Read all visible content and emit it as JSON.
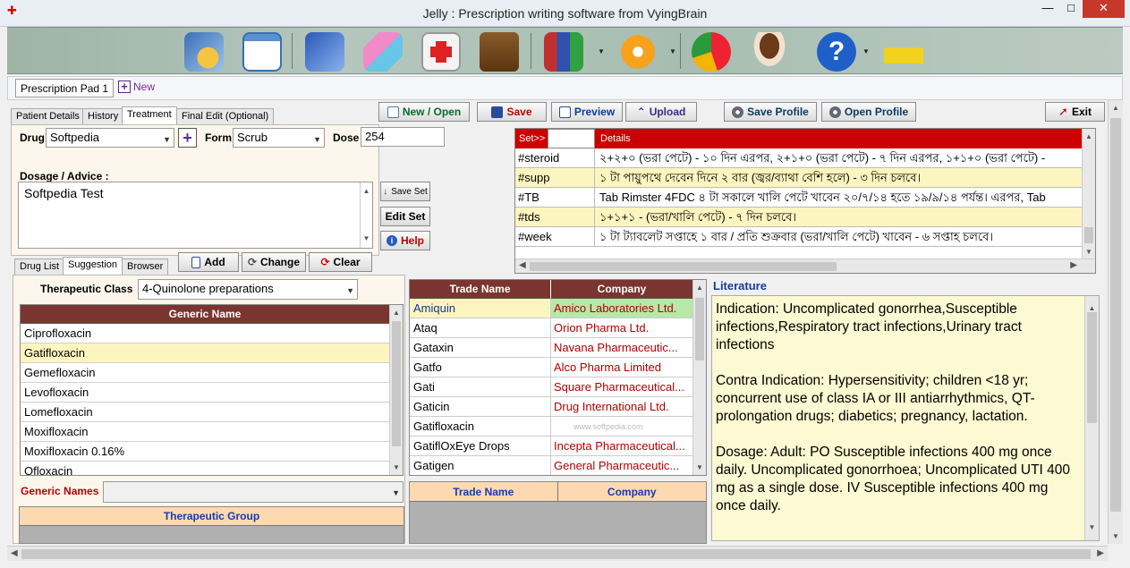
{
  "window": {
    "title": "Jelly : Prescription writing software from VyingBrain"
  },
  "toolbar": {
    "icons": [
      "clock-book-icon",
      "notepad-icon",
      "wizard-icon",
      "pills-icon",
      "first-aid-icon",
      "medical-bag-icon",
      "books-icon",
      "settings-gear-icon",
      "pie-chart-icon",
      "coffee-cup-icon",
      "help-icon",
      "car-icon"
    ]
  },
  "doc_tabs": {
    "active": "Prescription Pad 1",
    "new_label": "New"
  },
  "upper_tabs": [
    "Patient Details",
    "History",
    "Treatment",
    "Final Edit (Optional)"
  ],
  "actions": {
    "new_open": "New / Open",
    "save": "Save",
    "preview": "Preview",
    "upload": "Upload",
    "save_profile": "Save Profile",
    "open_profile": "Open Profile",
    "exit": "Exit"
  },
  "form": {
    "drug_label": "Drug",
    "drug_value": "Softpedia",
    "form_label": "Form",
    "form_value": "Scrub",
    "dose_label": "Dose",
    "dose_value": "254",
    "dosage_label": "Dosage / Advice :",
    "dosage_value": "Softpedia Test"
  },
  "side_buttons": {
    "save_set": "Save Set",
    "edit_set": "Edit Set",
    "help": "Help"
  },
  "lower_tabs": [
    "Drug List",
    "Suggestion",
    "Browser"
  ],
  "row_buttons": {
    "add": "Add",
    "change": "Change",
    "clear": "Clear"
  },
  "sets": {
    "headers": [
      "Set>>",
      "Details"
    ],
    "rows": [
      {
        "set": "#steroid",
        "details": "২+২+০ (ভরা পেটে) - ১০ দিন এরপর, ২+১+০ (ভরা পেটে) - ৭ দিন এরপর, ১+১+০ (ভরা পেটে) -"
      },
      {
        "set": "#supp",
        "details": "১ টা পায়ুপথে দেবেন দিনে ২ বার (জ্বর/ব্যাথা বেশি হলে) - ৩ দিন চলবে।"
      },
      {
        "set": "#TB",
        "details": "Tab Rimster 4FDC ৪ টা সকালে খালি পেটে খাবেন ২০/৭/১৪ হতে ১৯/৯/১৪ পর্যন্ত। এরপর, Tab"
      },
      {
        "set": "#tds",
        "details": "১+১+১  - (ভরা/খালি পেটে) -  ৭ দিন চলবে।"
      },
      {
        "set": "#week",
        "details": "১ টা ট্যাবলেট সপ্তাহে ১ বার / প্রতি শুক্রবার (ভরা/খালি পেটে) খাবেন - ৬ সপ্তাহ চলবে।"
      }
    ]
  },
  "therapeutic": {
    "label": "Therapeutic Class",
    "value": "4-Quinolone preparations"
  },
  "generic": {
    "header": "Generic Name",
    "items": [
      "Ciprofloxacin",
      "Gatifloxacin",
      "Gemefloxacin",
      "Levofloxacin",
      "Lomefloxacin",
      "Moxifloxacin",
      "Moxifloxacin 0.16%",
      "Ofloxacin"
    ],
    "selected": "Gatifloxacin"
  },
  "generic_names": {
    "label": "Generic Names",
    "value": ""
  },
  "therapeutic_group": {
    "header": "Therapeutic Group"
  },
  "trade": {
    "headers": [
      "Trade Name",
      "Company"
    ],
    "rows": [
      {
        "trade": "Amiquin",
        "company": "Amico Laboratories Ltd."
      },
      {
        "trade": "Ataq",
        "company": "Orion Pharma Ltd."
      },
      {
        "trade": "Gataxin",
        "company": "Navana Pharmaceutic..."
      },
      {
        "trade": "Gatfo",
        "company": "Alco Pharma Limited"
      },
      {
        "trade": "Gati",
        "company": "Square Pharmaceutical..."
      },
      {
        "trade": "Gaticin",
        "company": "Drug International Ltd."
      },
      {
        "trade": "Gatifloxacin",
        "company": ""
      },
      {
        "trade": "GatiflOxEye Drops",
        "company": "Incepta Pharmaceutical..."
      },
      {
        "trade": "Gatigen",
        "company": "General Pharmaceutic..."
      }
    ]
  },
  "trade2": {
    "headers": [
      "Trade Name",
      "Company"
    ]
  },
  "literature": {
    "title": "Literature",
    "paragraphs": [
      "Indication: Uncomplicated gonorrhea,Susceptible infections,Respiratory tract infections,Urinary tract infections",
      "Contra Indication: Hypersensitivity; children <18 yr; concurrent use of class IA or III antiarrhythmics, QT-prolongation drugs; diabetics; pregnancy, lactation.",
      "Dosage: Adult: PO Susceptible infections 400 mg once daily. Uncomplicated gonorrhoea; Uncomplicated UTI 400 mg as a single dose. IV Susceptible infections 400 mg once daily."
    ]
  },
  "watermark": "www.softpedia.com",
  "colors": {
    "header_maroon": "#7a3530",
    "set_header_red": "#cc0000",
    "selected_row": "#fdf5c0",
    "highlight_green": "#b6e8a8",
    "company_red": "#b30000",
    "peach_header": "#fcd9b0"
  }
}
